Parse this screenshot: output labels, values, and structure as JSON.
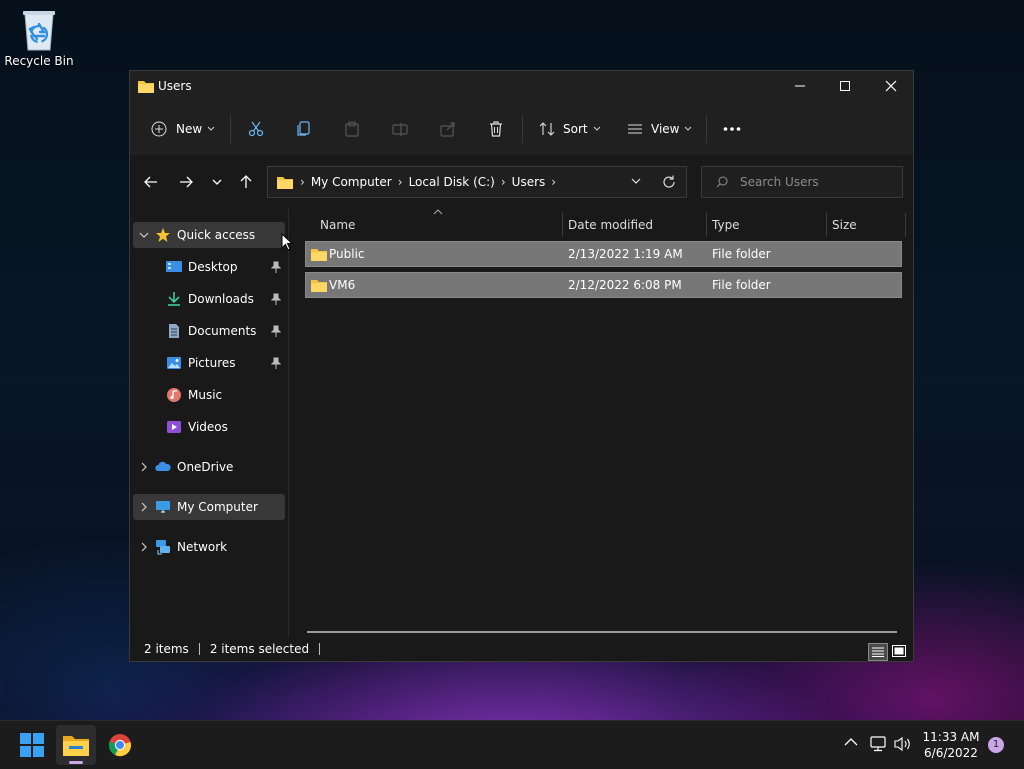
{
  "desktop": {
    "recycle_bin_label": "Recycle Bin"
  },
  "window": {
    "title": "Users",
    "toolbar": {
      "new_label": "New",
      "sort_label": "Sort",
      "view_label": "View"
    },
    "address": {
      "crumbs": [
        "My Computer",
        "Local Disk (C:)",
        "Users"
      ]
    },
    "search": {
      "placeholder": "Search Users"
    },
    "nav_pane": {
      "quick_access": "Quick access",
      "items": [
        "Desktop",
        "Downloads",
        "Documents",
        "Pictures",
        "Music",
        "Videos"
      ],
      "onedrive": "OneDrive",
      "my_computer": "My Computer",
      "network": "Network"
    },
    "columns": {
      "name": "Name",
      "date_modified": "Date modified",
      "type": "Type",
      "size": "Size"
    },
    "rows": [
      {
        "name": "Public",
        "date": "2/13/2022 1:19 AM",
        "type": "File folder",
        "size": ""
      },
      {
        "name": "VM6",
        "date": "2/12/2022 6:08 PM",
        "type": "File folder",
        "size": ""
      }
    ],
    "status": {
      "count": "2 items",
      "selected": "2 items selected"
    }
  },
  "taskbar": {
    "time": "11:33 AM",
    "date": "6/6/2022",
    "notification_count": "1"
  },
  "colors": {
    "folder": "#f5c542",
    "selection": "#777777",
    "accent": "#0a84ff"
  }
}
